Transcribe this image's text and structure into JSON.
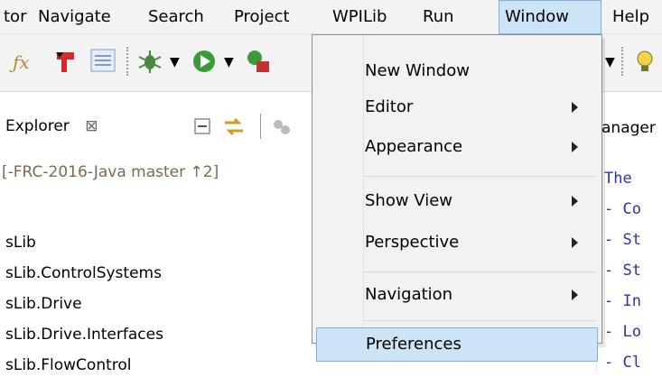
{
  "menubar": {
    "items": [
      "tor",
      "Navigate",
      "Search",
      "Project",
      "WPILib",
      "Run",
      "Window",
      "Help"
    ]
  },
  "toolbar": {
    "icons": [
      "function-icon",
      "plugin-icon",
      "list-icon",
      "debug-bug-icon",
      "run-icon",
      "coverage-icon",
      "lightbulb-icon"
    ]
  },
  "explorer": {
    "title": "Explorer",
    "close_glyph": "⊠"
  },
  "tree": {
    "rows": [
      "[-FRC-2016-Java master ↑2]",
      "sLib",
      "sLib.ControlSystems",
      "sLib.Drive",
      "sLib.Drive.Interfaces",
      "sLib.FlowControl"
    ]
  },
  "editor": {
    "tab_label": "anager",
    "lines": [
      "The",
      "- Co",
      "- St",
      "- St",
      "- In",
      "- Lo",
      "- Cl"
    ]
  },
  "window_menu": {
    "items": [
      {
        "label": "New Window",
        "submenu": false
      },
      {
        "label": "Editor",
        "submenu": true
      },
      {
        "label": "Appearance",
        "submenu": true
      },
      {
        "label": "Show View",
        "submenu": true
      },
      {
        "label": "Perspective",
        "submenu": true
      },
      {
        "label": "Navigation",
        "submenu": true
      },
      {
        "label": "Preferences",
        "submenu": false
      }
    ],
    "highlighted": "Preferences"
  },
  "colors": {
    "menu_bg": "#f3f3f3",
    "highlight_bg": "#cde3f6",
    "highlight_border": "#7fb2e0",
    "code_blue": "#2a33b0",
    "tree_git_text": "#7a6a4f"
  }
}
